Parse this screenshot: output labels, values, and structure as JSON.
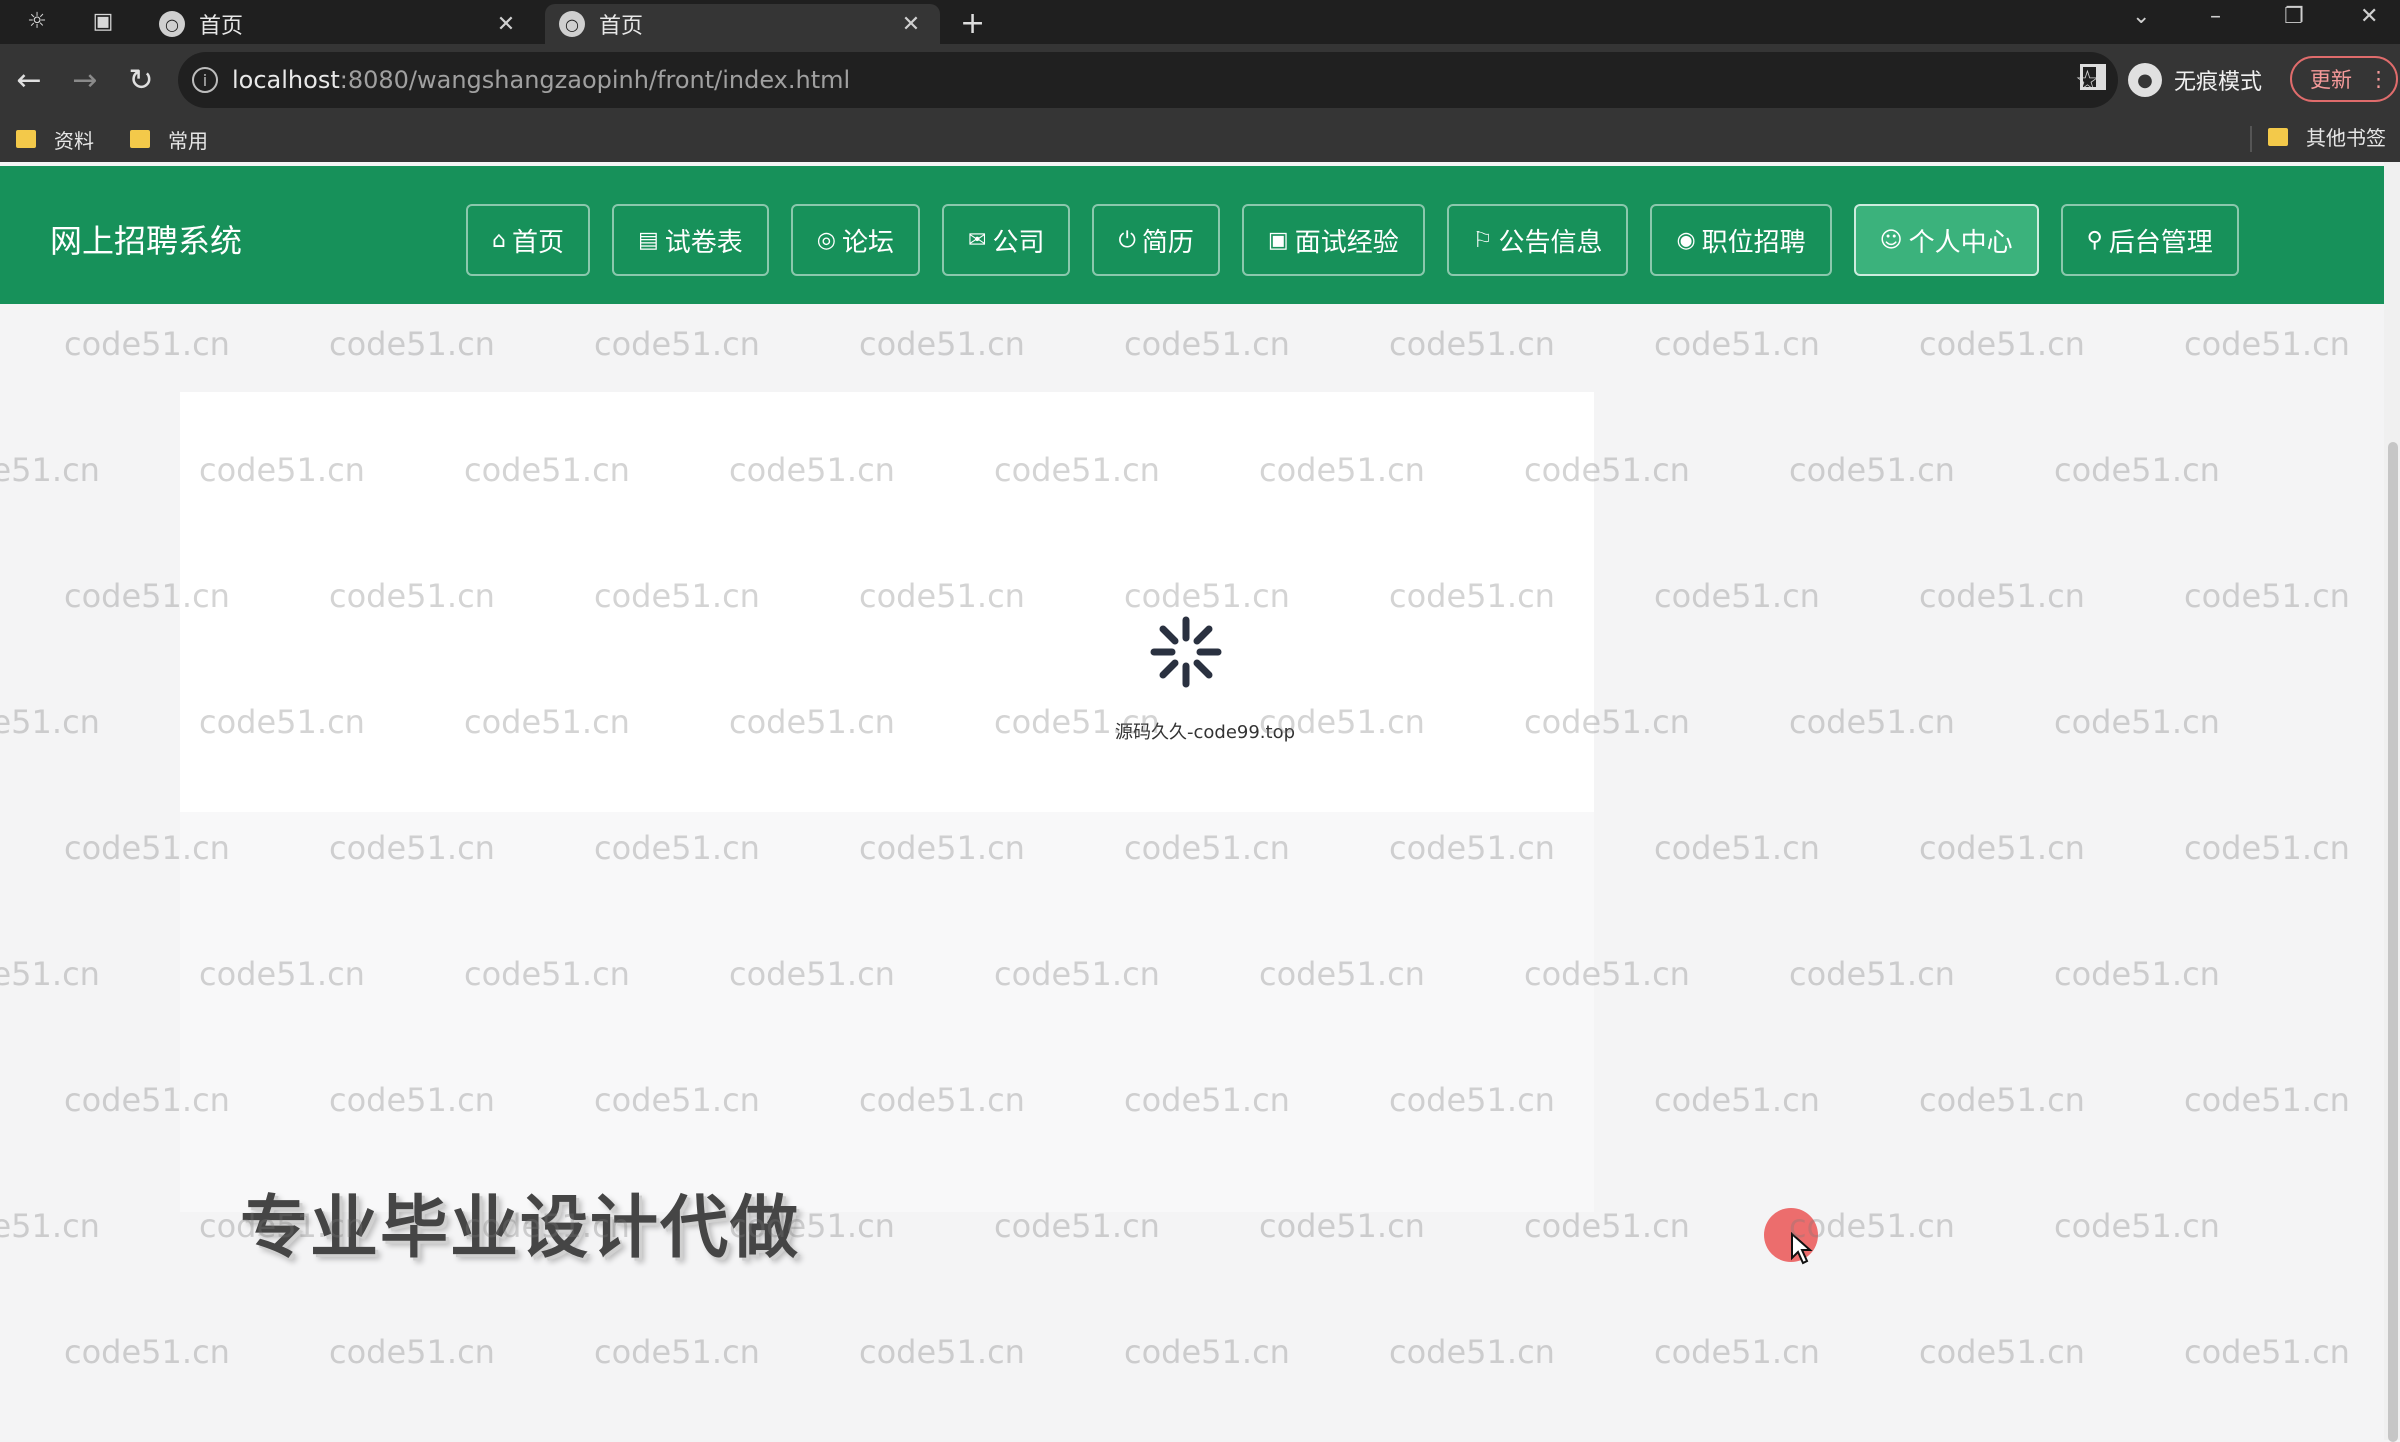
{
  "browser": {
    "tabs": [
      {
        "title": "首页",
        "active": false
      },
      {
        "title": "首页",
        "active": true
      }
    ],
    "url_host": "localhost",
    "url_rest": ":8080/wangshangzaopinh/front/index.html",
    "incognito_label": "无痕模式",
    "update_label": "更新",
    "bookmarks": [
      "资料",
      "常用"
    ],
    "other_bookmarks": "其他书签"
  },
  "site": {
    "title": "网上招聘系统",
    "menu": [
      {
        "icon": "home-icon",
        "glyph": "⌂",
        "label": "首页",
        "active": false
      },
      {
        "icon": "exam-icon",
        "glyph": "▤",
        "label": "试卷表",
        "active": false
      },
      {
        "icon": "forum-icon",
        "glyph": "◎",
        "label": "论坛",
        "active": false
      },
      {
        "icon": "company-icon",
        "glyph": "✉",
        "label": "公司",
        "active": false
      },
      {
        "icon": "resume-icon",
        "glyph": "⏻",
        "label": "简历",
        "active": false
      },
      {
        "icon": "interview-icon",
        "glyph": "▣",
        "label": "面试经验",
        "active": false
      },
      {
        "icon": "notice-icon",
        "glyph": "⚐",
        "label": "公告信息",
        "active": false
      },
      {
        "icon": "job-icon",
        "glyph": "◉",
        "label": "职位招聘",
        "active": false
      },
      {
        "icon": "user-icon",
        "glyph": "☺",
        "label": "个人中心",
        "active": true
      },
      {
        "icon": "link-icon",
        "glyph": "⚲",
        "label": "后台管理",
        "active": false
      }
    ]
  },
  "loading": {
    "text": "源码久久-code99.top"
  },
  "promo": {
    "text": "专业毕业设计代做"
  },
  "watermark": {
    "text": "code51.cn"
  },
  "colors": {
    "nav_green": "#17915a",
    "nav_active": "#3bb27c",
    "chrome_dark": "#1f1f1f",
    "chrome_bar": "#353535"
  }
}
